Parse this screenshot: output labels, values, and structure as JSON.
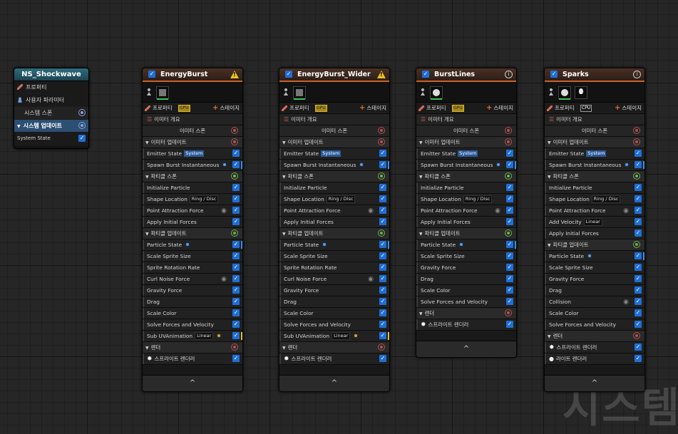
{
  "system": {
    "title": "NS_Shockwave",
    "rows": [
      "프로퍼티",
      "사용자 파라미터",
      "시스템 스폰",
      "시스템 업데이트",
      "System State"
    ]
  },
  "common": {
    "properties": "프로퍼티",
    "gpu": "GPU",
    "cpu": "CPU",
    "stage": "스테이지",
    "overview": "이미터 개요",
    "emitter_spawn": "이미터 스폰",
    "emitter_update": "이미터 업데이트",
    "particle_spawn": "파티클 스폰",
    "particle_update": "파티클 업데이트",
    "render": "렌더",
    "sprite_renderer": "스프라이트 렌더러",
    "light_renderer": "라이트 렌더러",
    "system_tag": "System",
    "ring_disc": "Ring / Disc",
    "linear": "Linear",
    "check": "✓",
    "collapse": "^"
  },
  "emitters": [
    {
      "name": "EnergyBurst",
      "badge": "warning",
      "emitter_update": [
        "Emitter State",
        "Spawn Burst Instantaneous"
      ],
      "particle_spawn": [
        "Initialize Particle",
        "Shape Location",
        "Point Attraction Force",
        "Apply Initial Forces"
      ],
      "particle_update": [
        "Particle State",
        "Scale Sprite Size",
        "Sprite Rotation Rate",
        "Curl Noise Force",
        "Gravity Force",
        "Drag",
        "Scale Color",
        "Solve Forces and Velocity",
        "Sub UVAnimation"
      ]
    },
    {
      "name": "EnergyBurst_Wider",
      "badge": "warning",
      "emitter_update": [
        "Emitter State",
        "Spawn Burst Instantaneous"
      ],
      "particle_spawn": [
        "Initialize Particle",
        "Shape Location",
        "Point Attraction Force",
        "Apply Initial Forces"
      ],
      "particle_update": [
        "Particle State",
        "Scale Sprite Size",
        "Sprite Rotation Rate",
        "Curl Noise Force",
        "Gravity Force",
        "Drag",
        "Scale Color",
        "Solve Forces and Velocity",
        "Sub UVAnimation"
      ]
    },
    {
      "name": "BurstLines",
      "badge": "info",
      "emitter_update": [
        "Emitter State",
        "Spawn Burst Instantaneous"
      ],
      "particle_spawn": [
        "Initialize Particle",
        "Shape Location",
        "Point Attraction Force",
        "Apply Initial Forces"
      ],
      "particle_update": [
        "Particle State",
        "Scale Sprite Size",
        "Gravity Force",
        "Drag",
        "Scale Color",
        "Solve Forces and Velocity"
      ]
    },
    {
      "name": "Sparks",
      "badge": "info",
      "emitter_update": [
        "Emitter State",
        "Spawn Burst Instantaneous"
      ],
      "particle_spawn": [
        "Initialize Particle",
        "Shape Location",
        "Point Attraction Force",
        "Add Velocity",
        "Apply Initial Forces"
      ],
      "particle_update": [
        "Particle State",
        "Scale Sprite Size",
        "Gravity Force",
        "Drag",
        "Collision",
        "Scale Color",
        "Solve Forces and Velocity"
      ]
    }
  ],
  "watermark": "시스템",
  "colors": {
    "accent": "#1f6fd6",
    "emitter_header": "#c8622a",
    "system_header": "#2e6c7c"
  }
}
